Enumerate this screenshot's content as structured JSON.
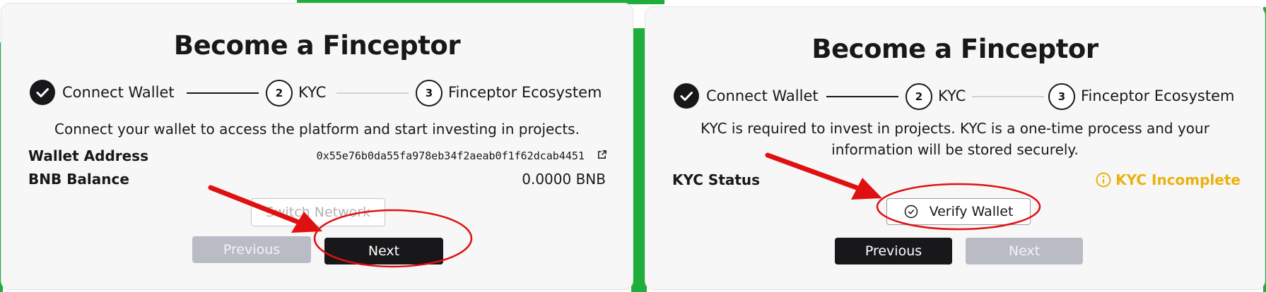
{
  "colors": {
    "accent_dark": "#18181b",
    "disabled_button": "#b9bcc4",
    "warning": "#e9b20f",
    "annotation_red": "#e01010",
    "background_green": "#1fae3c"
  },
  "left_panel": {
    "title": "Become a Finceptor",
    "steps": [
      {
        "label": "Connect Wallet",
        "state": "done",
        "icon": "check-icon"
      },
      {
        "number": "2",
        "label": "KYC",
        "state": "current"
      },
      {
        "number": "3",
        "label": "Finceptor Ecosystem",
        "state": "upcoming"
      }
    ],
    "description": "Connect your wallet to access the platform and start investing in projects.",
    "wallet_address_label": "Wallet Address",
    "wallet_address_value": "0x55e76b0da55fa978eb34f2aeab0f1f62dcab4451",
    "external_link_icon": "external-link-icon",
    "bnb_balance_label": "BNB Balance",
    "bnb_balance_value": "0.0000 BNB",
    "switch_network_label": "Switch Network",
    "previous_label": "Previous",
    "next_label": "Next"
  },
  "right_panel": {
    "title": "Become a Finceptor",
    "steps": [
      {
        "label": "Connect Wallet",
        "state": "done",
        "icon": "check-icon"
      },
      {
        "number": "2",
        "label": "KYC",
        "state": "current"
      },
      {
        "number": "3",
        "label": "Finceptor Ecosystem",
        "state": "upcoming"
      }
    ],
    "description_line1": "KYC is required to invest in projects. KYC is a one-time process and your",
    "description_line2": "information will be stored securely.",
    "kyc_status_label": "KYC Status",
    "kyc_status_value": "KYC Incomplete",
    "kyc_status_icon": "info-icon",
    "verify_wallet_label": "Verify Wallet",
    "verify_wallet_icon": "check-circle-icon",
    "previous_label": "Previous",
    "next_label": "Next"
  }
}
